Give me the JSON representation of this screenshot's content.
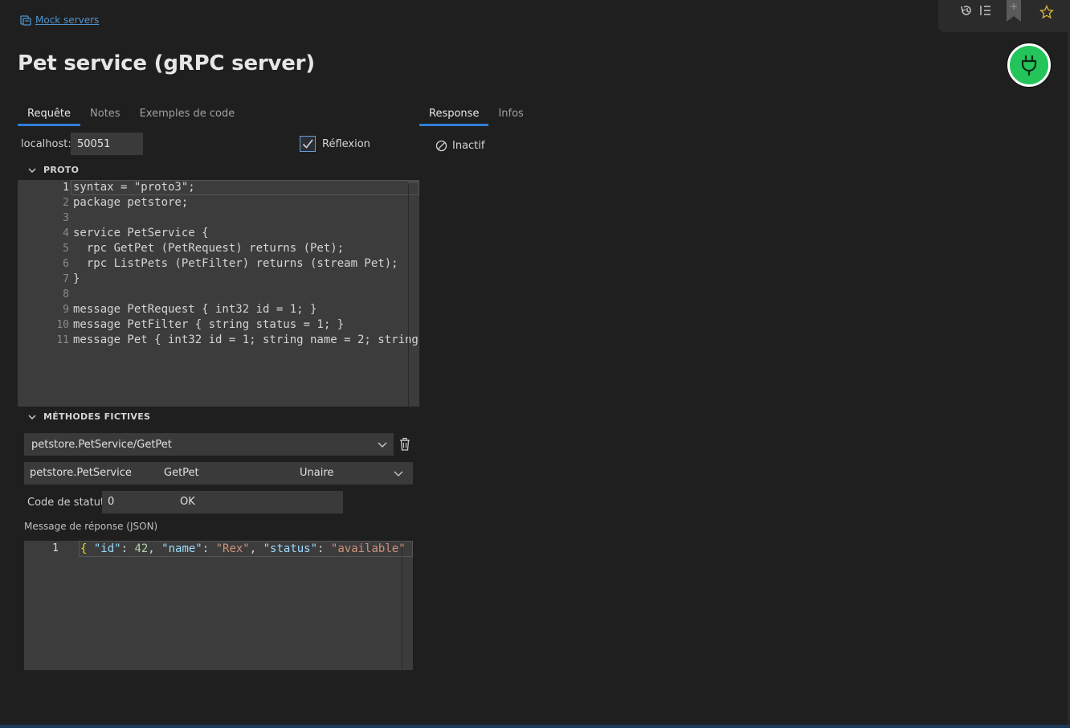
{
  "breadcrumb": {
    "link_label": "Mock servers"
  },
  "page": {
    "title": "Pet service (gRPC server)"
  },
  "request_tabs": [
    {
      "label": "Requête",
      "active": true
    },
    {
      "label": "Notes",
      "active": false
    },
    {
      "label": "Exemples de code",
      "active": false
    }
  ],
  "response_tabs": [
    {
      "label": "Response",
      "active": true
    },
    {
      "label": "Infos",
      "active": false
    }
  ],
  "host": {
    "label": "localhost:",
    "port": "50051"
  },
  "reflection": {
    "label": "Réflexion",
    "checked": true
  },
  "proto": {
    "section_title": "PROTO",
    "lines": [
      {
        "n": "1",
        "code": "syntax = \"proto3\";"
      },
      {
        "n": "2",
        "code": "package petstore;"
      },
      {
        "n": "3",
        "code": ""
      },
      {
        "n": "4",
        "code": "service PetService {"
      },
      {
        "n": "5",
        "code": "  rpc GetPet (PetRequest) returns (Pet);"
      },
      {
        "n": "6",
        "code": "  rpc ListPets (PetFilter) returns (stream Pet);"
      },
      {
        "n": "7",
        "code": "}"
      },
      {
        "n": "8",
        "code": ""
      },
      {
        "n": "9",
        "code": "message PetRequest { int32 id = 1; }"
      },
      {
        "n": "10",
        "code": "message PetFilter { string status = 1; }"
      },
      {
        "n": "11",
        "code": "message Pet { int32 id = 1; string name = 2; string"
      }
    ]
  },
  "methods": {
    "section_title": "MÉTHODES FICTIVES",
    "selected_method": "petstore.PetService/GetPet",
    "service": "petstore.PetService",
    "method": "GetPet",
    "kind": "Unaire"
  },
  "status": {
    "label": "Code de statut",
    "code": "0",
    "text": "OK"
  },
  "response_json": {
    "label": "Message de réponse (JSON)",
    "line_number": "1",
    "tokens": {
      "open": "{ ",
      "k1": "\"id\"",
      "c1": ": ",
      "v1": "42",
      "s1": ", ",
      "k2": "\"name\"",
      "c2": ": ",
      "v2": "\"Rex\"",
      "s2": ", ",
      "k3": "\"status\"",
      "c3": ": ",
      "v3": "\"available\""
    }
  },
  "response_panel": {
    "status_text": "Inactif"
  },
  "icons": {
    "mock-server": "mock-server-icon",
    "history": "history-icon",
    "list": "list-icon",
    "bookmark": "bookmark-icon",
    "star": "star-icon",
    "power": "plug-icon",
    "trash": "trash-icon",
    "chevron": "chevron-down-icon",
    "inactive": "circle-slash-icon"
  },
  "colors": {
    "accent": "#2f7ed8",
    "power_on": "#23c45a",
    "star": "#e0b33a",
    "link": "#4e94ce"
  }
}
